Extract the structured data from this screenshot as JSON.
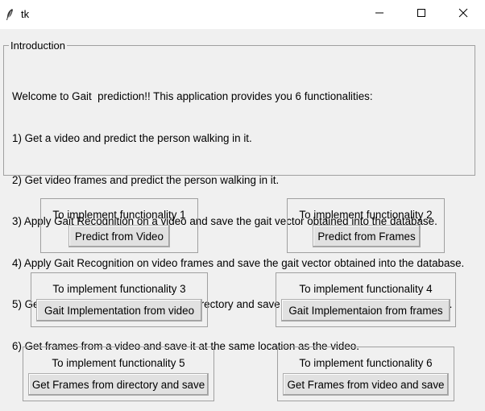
{
  "window": {
    "title": "tk",
    "icon": "feather-icon",
    "controls": [
      "minimize-icon",
      "maximize-icon",
      "close-icon"
    ]
  },
  "intro": {
    "frame_label": "Introduction",
    "lines": [
      "Welcome to Gait  prediction!! This application provides you 6 functionalities:",
      "1) Get a video and predict the person walking in it.",
      "2) Get video frames and predict the person walking in it.",
      "3) Apply Gait Recognition on a video and save the gait vector obtained into the database.",
      "4) Apply Gait Recognition on video frames and save the gait vector obtained into the database.",
      "5) Get frames from all the videos in a directory and save it at the same location as the video.",
      "6) Get frames from a video and save it at the same location as the video."
    ]
  },
  "groups": [
    {
      "label": "To implement functionality 1",
      "button": "Predict from Video"
    },
    {
      "label": "To implement functionality 2",
      "button": "Predict from Frames"
    },
    {
      "label": "To implement functionality 3",
      "button": "Gait Implementation from video"
    },
    {
      "label": "To implement functionality 4",
      "button": "Gait Implementaion from frames"
    },
    {
      "label": "To implement functionality 5",
      "button": "Get Frames from directory and save"
    },
    {
      "label": "To implement functionality 6",
      "button": "Get Frames from video and save"
    }
  ]
}
